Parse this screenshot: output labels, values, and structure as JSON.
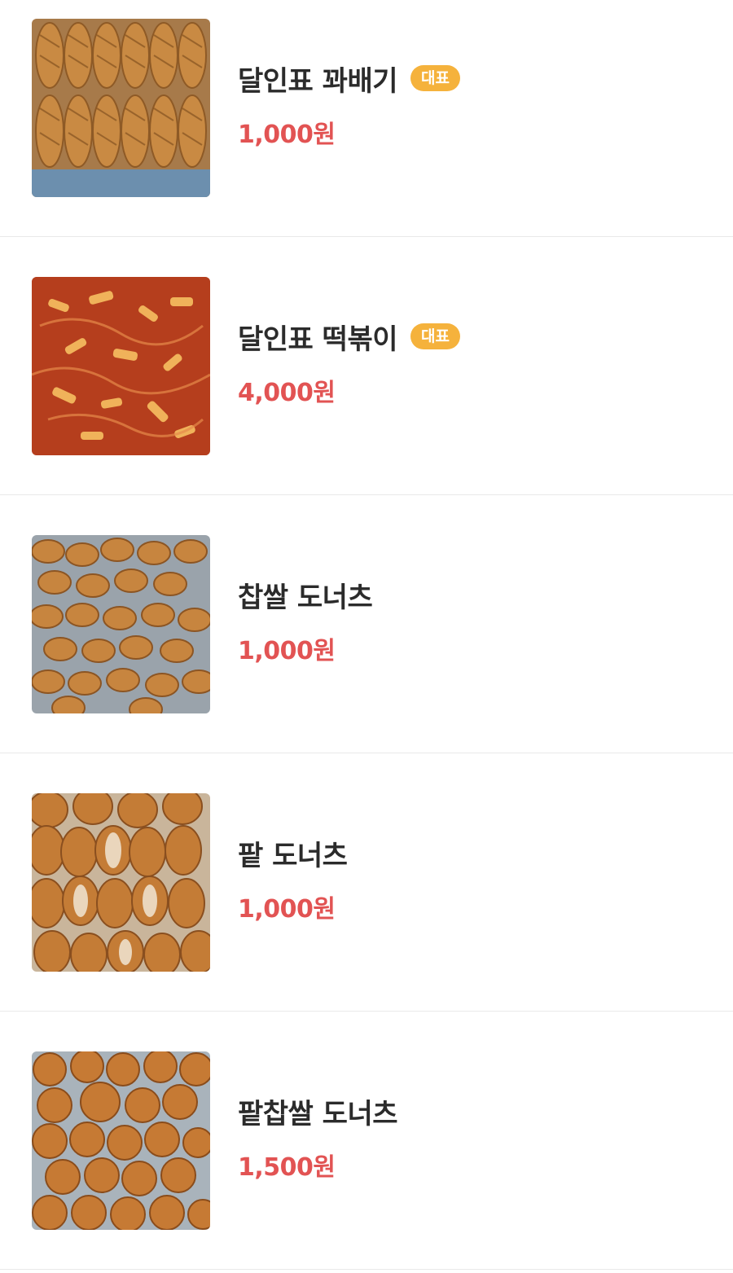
{
  "menu": {
    "items": [
      {
        "name": "달인표 꽈배기",
        "price": "1,000원",
        "badge": "대표",
        "photo_icon": "twisted-donut-photo"
      },
      {
        "name": "달인표 떡볶이",
        "price": "4,000원",
        "badge": "대표",
        "photo_icon": "tteokbokki-photo"
      },
      {
        "name": "찹쌀 도너츠",
        "price": "1,000원",
        "badge": "",
        "photo_icon": "rice-donut-photo"
      },
      {
        "name": "팥 도너츠",
        "price": "1,000원",
        "badge": "",
        "photo_icon": "red-bean-donut-photo"
      },
      {
        "name": "팥찹쌀 도너츠",
        "price": "1,500원",
        "badge": "",
        "photo_icon": "red-bean-rice-donut-photo"
      }
    ]
  },
  "colors": {
    "price": "#e25353",
    "badge_bg": "#f5b23c",
    "badge_text": "#ffffff",
    "name": "#2b2b2b",
    "divider": "#e9e9e9"
  }
}
